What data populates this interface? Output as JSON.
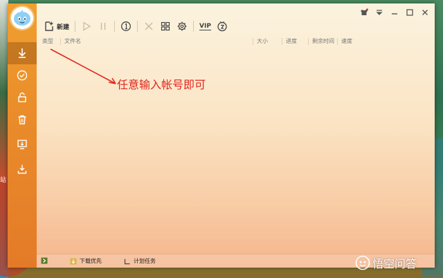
{
  "toolbar": {
    "new_label": "新建",
    "vip_label": "VIP"
  },
  "columns": {
    "type": "类型",
    "filename": "文件名",
    "size": "大小",
    "progress": "进度",
    "remaining": "剩余时间",
    "speed": "速度"
  },
  "annotation": {
    "text": "任意输入帐号即可",
    "color": "#e2241c"
  },
  "footer": {
    "download_priority": "下载优先",
    "scheduled_task": "计划任务"
  },
  "watermark": {
    "text": "悟空问答"
  },
  "desktop": {
    "left_edge_label": "站"
  },
  "theme": {
    "accent": "#ea8d2a"
  }
}
